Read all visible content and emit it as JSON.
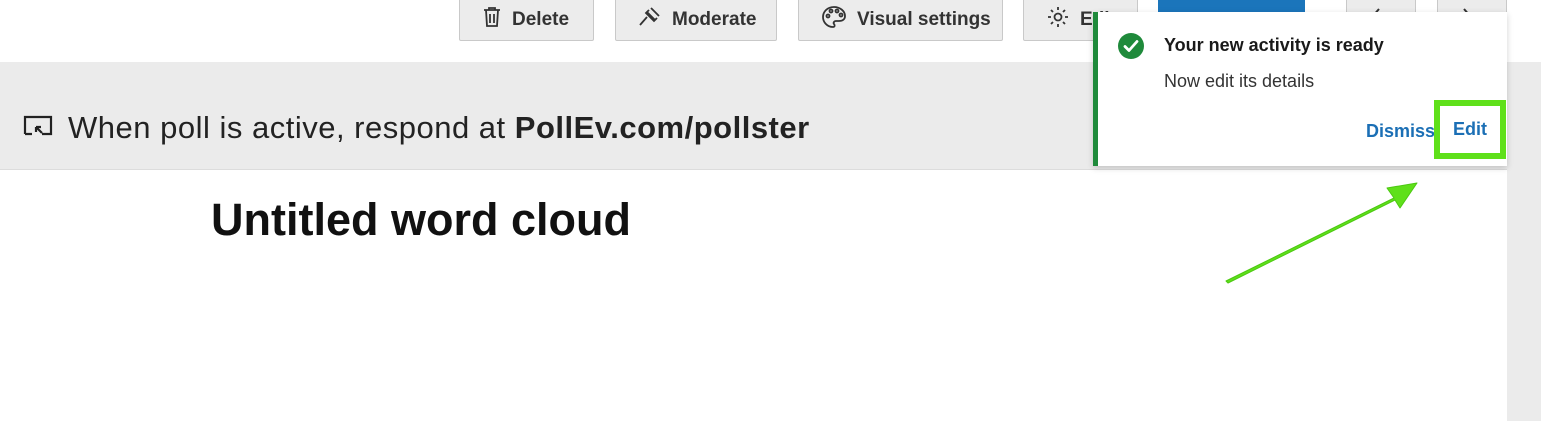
{
  "toolbar": {
    "delete_label": "Delete",
    "moderate_label": "Moderate",
    "visual_settings_label": "Visual settings",
    "edit_label": "Edit",
    "icons": [
      "trash-icon",
      "gavel-icon",
      "palette-icon",
      "gear-icon",
      "chevron-left-icon",
      "chevron-right-icon"
    ]
  },
  "banner": {
    "prefix": "When poll is active, respond at",
    "url": "PollEv.com/pollster",
    "icon": "screen-share-icon"
  },
  "activity": {
    "title": "Untitled word cloud"
  },
  "toast": {
    "title": "Your new activity is ready",
    "message": "Now edit its details",
    "dismiss_label": "Dismiss",
    "edit_label": "Edit",
    "icon": "check-circle-icon",
    "accent_color": "#1f8a3b",
    "highlight_color": "#5fe01a"
  },
  "colors": {
    "link": "#1b6fb5",
    "primary": "#1b75bb",
    "strip": "#ebebeb"
  }
}
